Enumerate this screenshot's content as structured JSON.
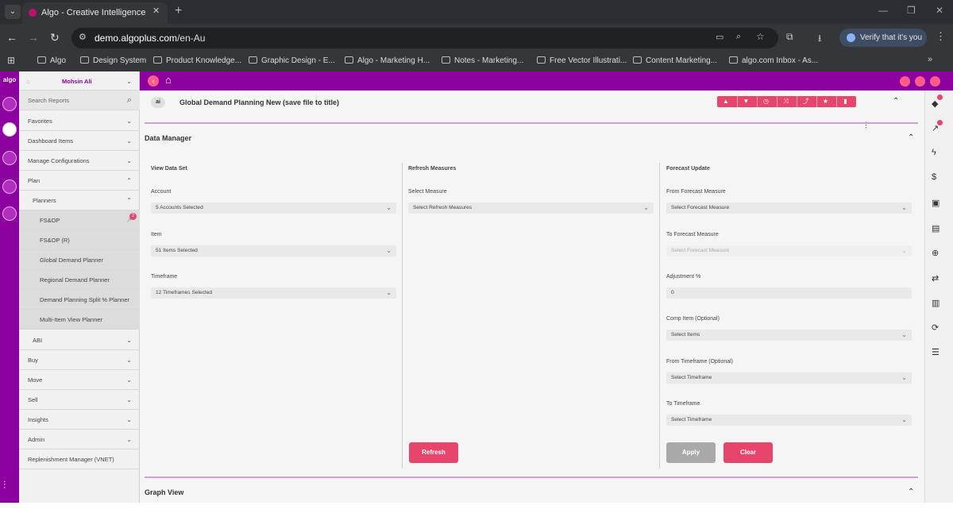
{
  "browser": {
    "tab_title": "Algo - Creative Intelligence",
    "url_host": "demo.algoplus.com",
    "url_path": "/en-Au",
    "verify_label": "Verify that it's you",
    "bookmarks": [
      "Algo",
      "Design System",
      "Product Knowledge...",
      "Graphic Design - E...",
      "Algo - Marketing H...",
      "Notes - Marketing...",
      "Free Vector Illustrati...",
      "Content Marketing...",
      "algo.com Inbox - As..."
    ]
  },
  "rail": {
    "logo": "algo"
  },
  "sidebar": {
    "user": "Mohsin Ali",
    "search_placeholder": "Search Reports",
    "items": [
      "Favorites",
      "Dashboard Items",
      "Manage Configurations",
      "Plan",
      "Planners",
      "FS&OP",
      "FS&OP (R)",
      "Global Demand Planner",
      "Regional Demand Planner",
      "Demand Planning Split % Planner",
      "Multi-Item View Planner",
      "ABI",
      "Buy",
      "Move",
      "Sell",
      "Insights",
      "Admin",
      "Replenishment Manager (VNET)"
    ],
    "badge": "2"
  },
  "report": {
    "title": "Global Demand Planning New (save file to title)",
    "logo_text": "ai"
  },
  "data_manager": {
    "title": "Data Manager",
    "view": {
      "heading": "View Data Set",
      "account_label": "Account",
      "account_value": "5 Accounts Selected",
      "item_label": "Item",
      "item_value": "51 Items Selected",
      "timeframe_label": "Timeframe",
      "timeframe_value": "12 Timeframes Selected"
    },
    "refresh": {
      "heading": "Refresh Measures",
      "measure_label": "Select Measure",
      "measure_value": "Select Refresh Measures",
      "button": "Refresh"
    },
    "forecast": {
      "heading": "Forecast Update",
      "from_label": "From Forecast Measure",
      "from_value": "Select Forecast Measure",
      "to_label": "To Forecast Measure",
      "to_value": "Select Forecast Measure",
      "adj_label": "Adjustment %",
      "adj_value": "0",
      "comp_label": "Comp Item (Optional)",
      "comp_value": "Select Items",
      "fromtf_label": "From Timeframe (Optional)",
      "fromtf_value": "Select Timeframe",
      "totf_label": "To Timeframe",
      "totf_value": "Select Timeframe",
      "apply": "Apply",
      "clear": "Clear"
    }
  },
  "graph": {
    "title": "Graph View"
  },
  "colors": {
    "brand": "#8b009e",
    "accent": "#e8456c"
  }
}
